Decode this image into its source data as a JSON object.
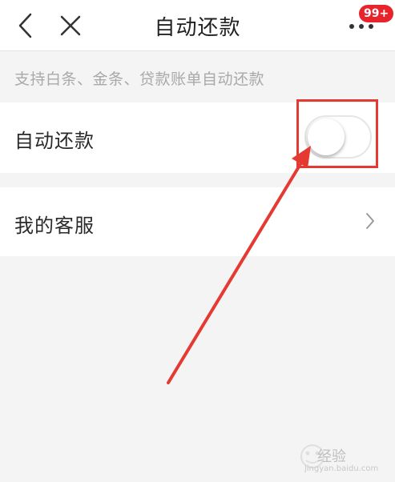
{
  "nav": {
    "title": "自动还款",
    "back_icon": "chevron-left-icon",
    "close_icon": "close-icon",
    "more_icon": "more-dots-icon",
    "badge": "99+"
  },
  "description": "支持白条、金条、贷款账单自动还款",
  "settings": {
    "auto_repay": {
      "label": "自动还款",
      "toggle_on": false
    },
    "customer_service": {
      "label": "我的客服",
      "chevron_icon": "chevron-right-icon"
    }
  },
  "annotation": {
    "highlight_color": "#e53a32"
  },
  "watermark": {
    "text": "经验",
    "sub": "jingyan.baidu.com"
  },
  "colors": {
    "badge": "#e8232b",
    "background": "#f4f4f4",
    "row": "#ffffff"
  }
}
